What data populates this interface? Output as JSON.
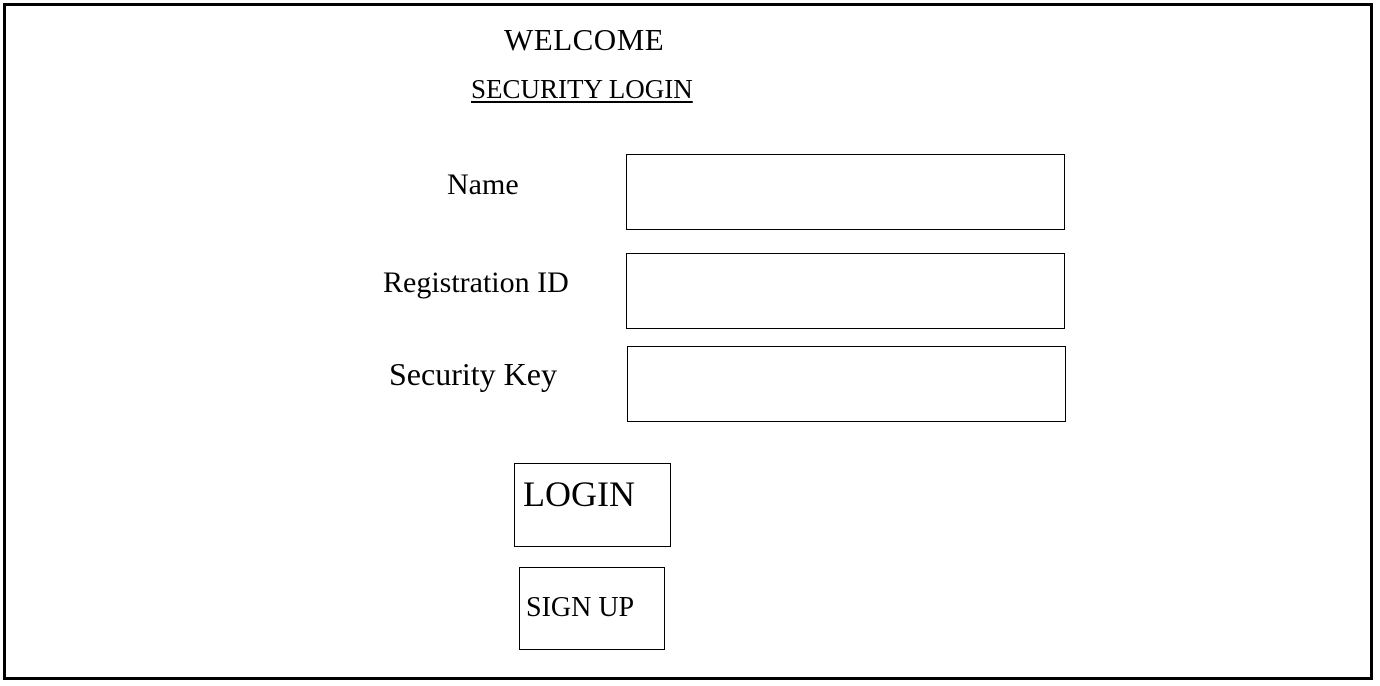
{
  "header": {
    "title": "WELCOME",
    "subtitle": "SECURITY LOGIN"
  },
  "form": {
    "fields": [
      {
        "label": "Name",
        "value": "",
        "placeholder": ""
      },
      {
        "label": "Registration ID",
        "value": "",
        "placeholder": ""
      },
      {
        "label": "Security Key",
        "value": "",
        "placeholder": ""
      }
    ]
  },
  "actions": {
    "login_label": "LOGIN",
    "signup_label": "SIGN UP"
  },
  "colors": {
    "background": "#ffffff",
    "border": "#000000",
    "text": "#000000"
  }
}
